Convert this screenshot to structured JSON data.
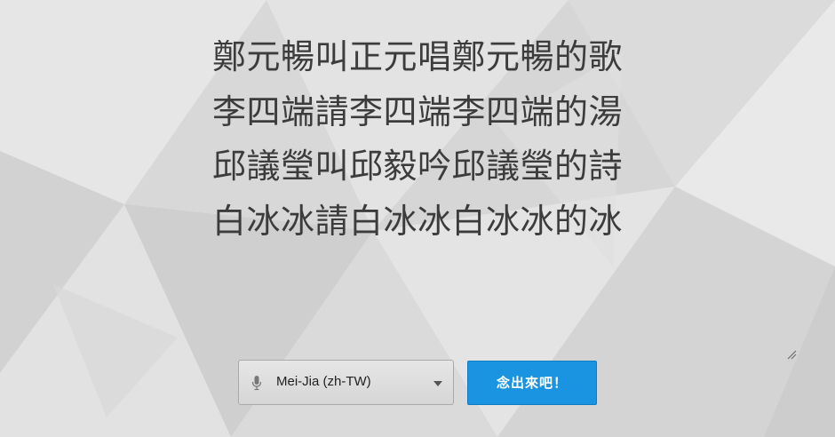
{
  "poem": {
    "text": "鄭元暢叫正元唱鄭元暢的歌\n李四端請李四端李四端的湯\n邱議瑩叫邱毅吟邱議瑩的詩\n白冰冰請白冰冰白冰冰的冰"
  },
  "voice_select": {
    "icon": "microphone-icon",
    "selected": "Mei-Jia (zh-TW)"
  },
  "speak_button": {
    "label": "念出來吧！",
    "color": "#1a94e0"
  },
  "colors": {
    "background": "#dcdcdc",
    "text": "#3c3c3c"
  }
}
